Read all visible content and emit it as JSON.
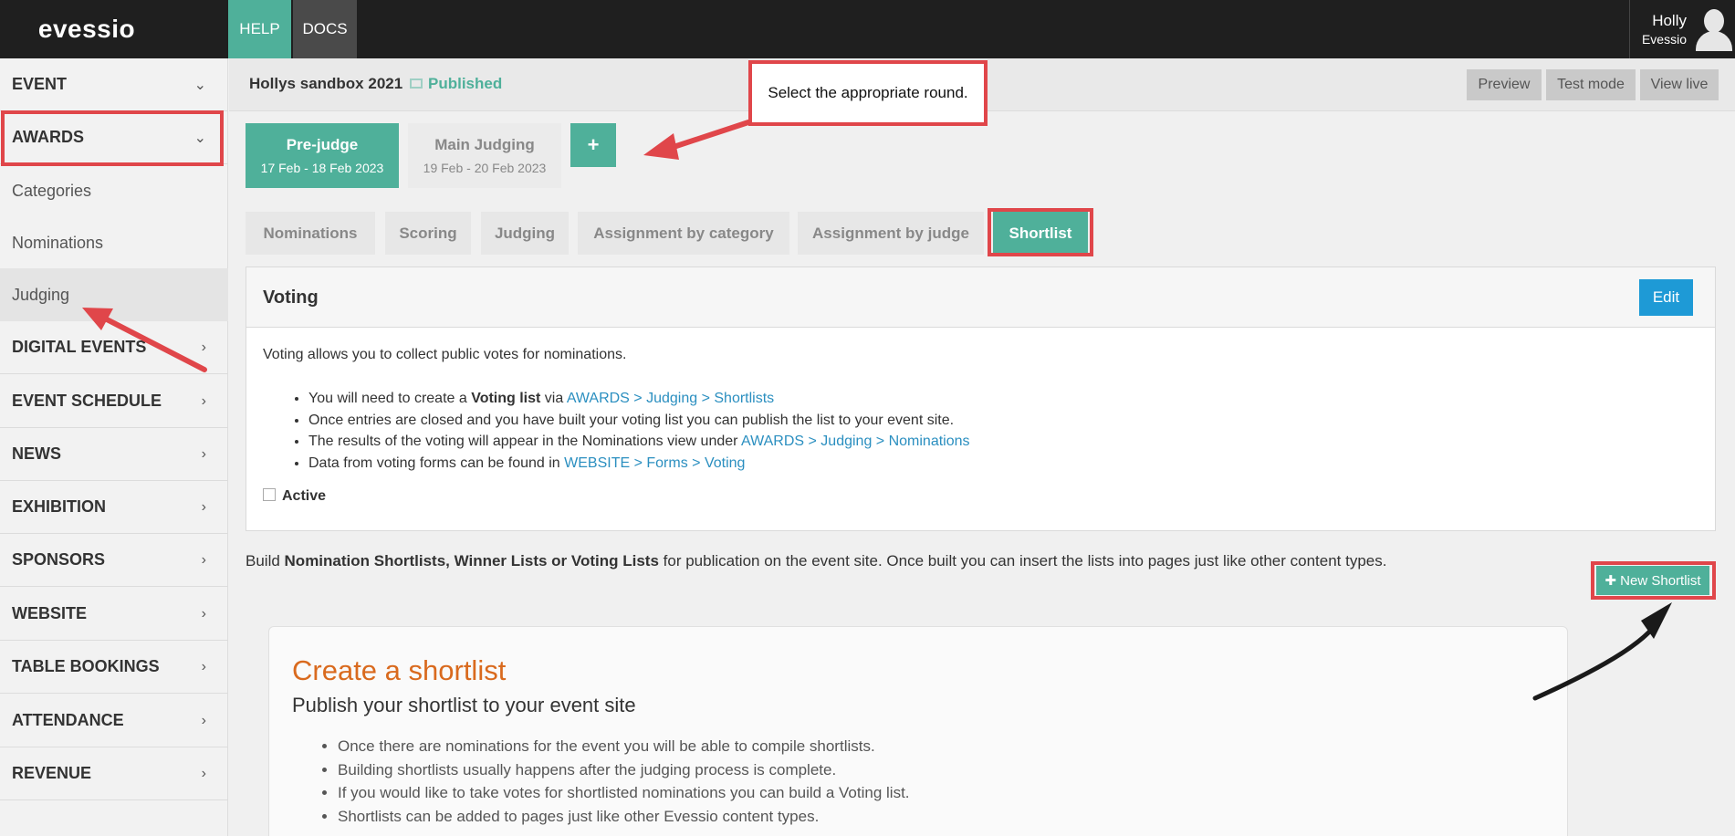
{
  "topbar": {
    "logo": "evessio",
    "tabs": [
      "HELP",
      "DOCS"
    ],
    "user_name": "Holly",
    "user_org": "Evessio"
  },
  "sidebar": {
    "items": [
      {
        "label": "EVENT",
        "chevron": "chevron-down"
      },
      {
        "label": "AWARDS",
        "chevron": "chevron-down"
      },
      {
        "label": "DIGITAL EVENTS",
        "chevron": "chevron-right"
      },
      {
        "label": "EVENT SCHEDULE",
        "chevron": "chevron-right"
      },
      {
        "label": "NEWS",
        "chevron": "chevron-right"
      },
      {
        "label": "EXHIBITION",
        "chevron": "chevron-right"
      },
      {
        "label": "SPONSORS",
        "chevron": "chevron-right"
      },
      {
        "label": "WEBSITE",
        "chevron": "chevron-right"
      },
      {
        "label": "TABLE BOOKINGS",
        "chevron": "chevron-right"
      },
      {
        "label": "ATTENDANCE",
        "chevron": "chevron-right"
      },
      {
        "label": "REVENUE",
        "chevron": "chevron-right"
      }
    ],
    "awards_sub": [
      "Categories",
      "Nominations",
      "Judging"
    ],
    "chevron_down_glyph": "⌄",
    "chevron_right_glyph": "›"
  },
  "header": {
    "event_title": "Hollys sandbox 2021",
    "status": "Published",
    "buttons": [
      "Preview",
      "Test mode",
      "View live"
    ]
  },
  "rounds": [
    {
      "title": "Pre-judge",
      "dates": "17 Feb - 18 Feb 2023",
      "active": true
    },
    {
      "title": "Main Judging",
      "dates": "19 Feb - 20 Feb 2023",
      "active": false
    }
  ],
  "add_round_label": "+",
  "callout": "Select the appropriate round.",
  "subtabs": [
    "Nominations",
    "Scoring",
    "Judging",
    "Assignment by category",
    "Assignment by judge",
    "Shortlist"
  ],
  "voting": {
    "title": "Voting",
    "edit_label": "Edit",
    "intro": "Voting allows you to collect public votes for nominations.",
    "b1_pre": "You will need to create a ",
    "b1_bold": "Voting list",
    "b1_mid": " via ",
    "b1_link": "AWARDS > Judging > Shortlists",
    "b2": "Once entries are closed and you have built your voting list you can publish the list to your event site.",
    "b3_pre": "The results of the voting will appear in the Nominations view under ",
    "b3_link": "AWARDS > Judging > Nominations",
    "b4_pre": "Data from voting forms can be found in ",
    "b4_link": "WEBSITE > Forms > Voting",
    "active_label": "Active"
  },
  "build": {
    "pre": "Build ",
    "bold": "Nomination Shortlists, Winner Lists or Voting Lists",
    "post": " for publication on the event site. Once built you can insert the lists into pages just like other content types."
  },
  "new_shortlist_label": "✚ New Shortlist",
  "create_card": {
    "title": "Create a shortlist",
    "subtitle": "Publish your shortlist to your event site",
    "bullets": [
      "Once there are nominations for the event you will be able to compile shortlists.",
      "Building shortlists usually happens after the judging process is complete.",
      "If you would like to take votes for shortlisted nominations you can build a Voting list.",
      "Shortlists can be added to pages just like other Evessio content types."
    ]
  },
  "colors": {
    "accent": "#4fb09a",
    "annotation_red": "#e0464a",
    "link": "#2b8fc0",
    "edit_blue": "#1e9ad6",
    "heading_orange": "#d96a1e"
  }
}
